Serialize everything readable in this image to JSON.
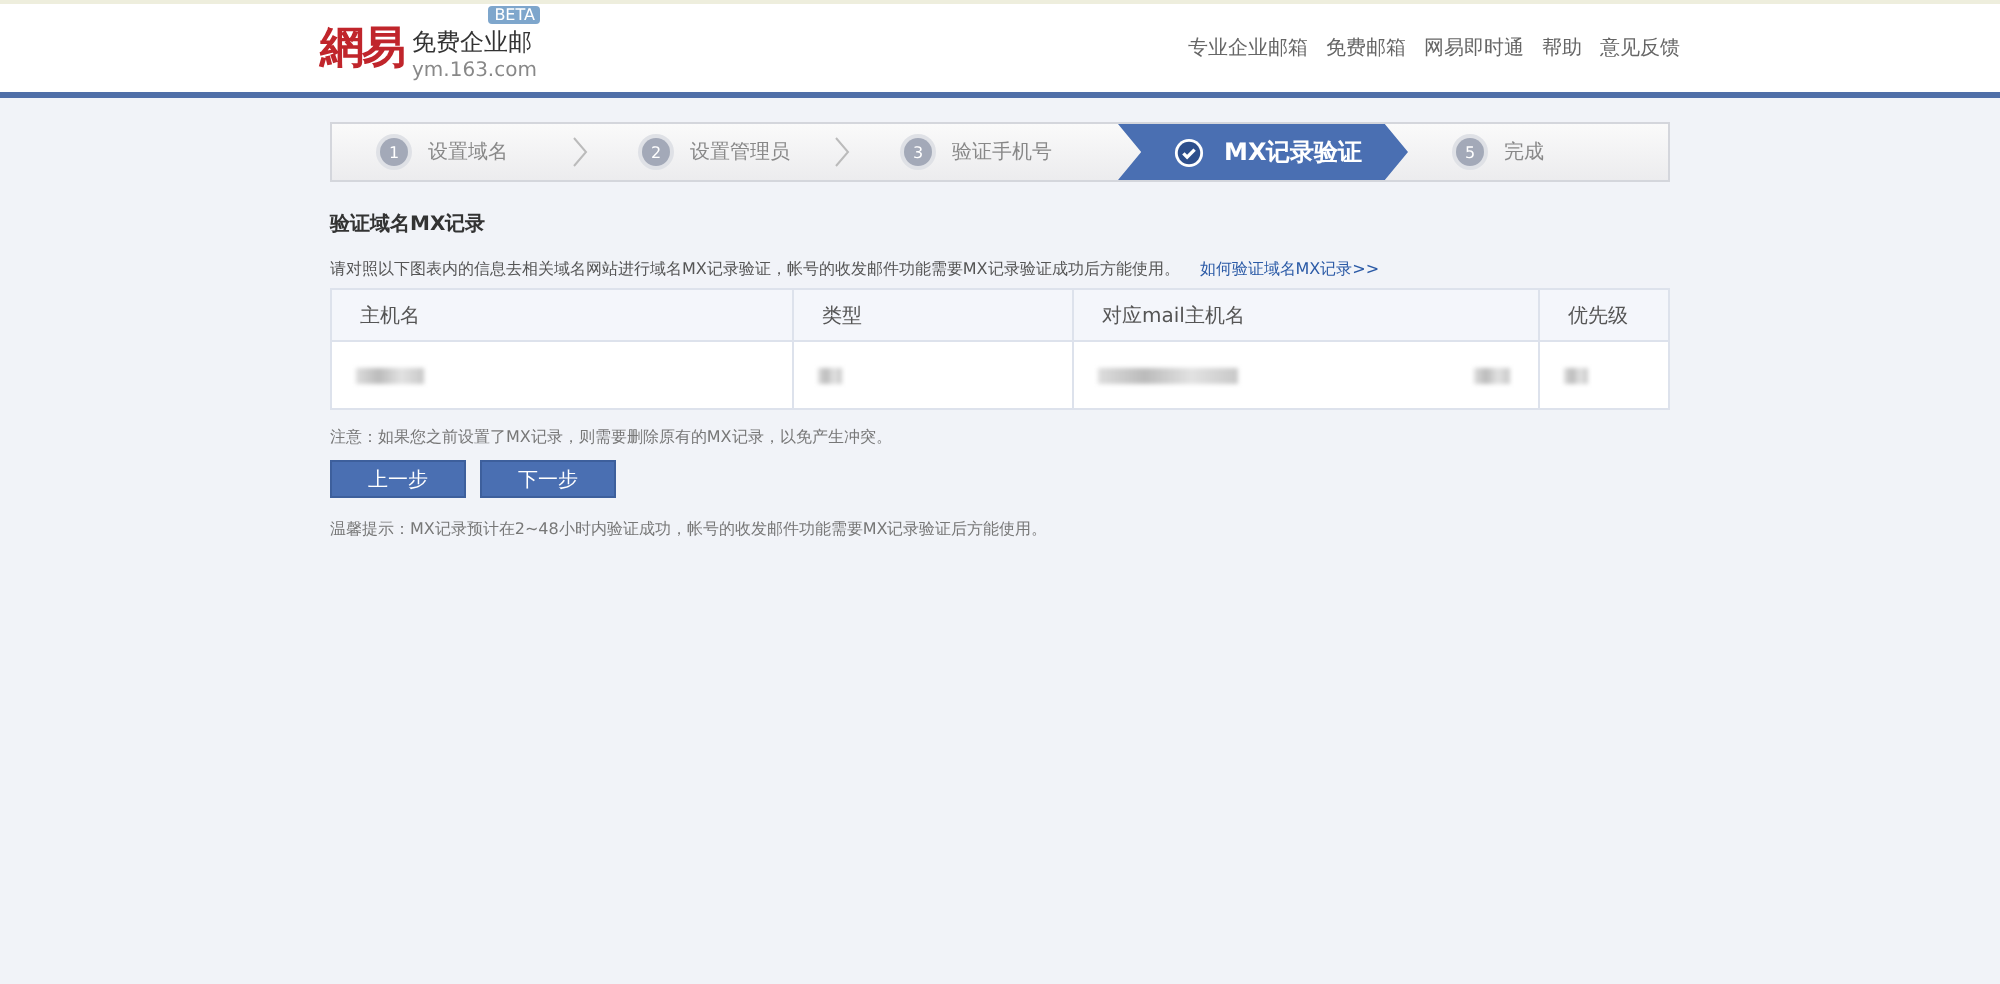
{
  "header": {
    "logo": "網易",
    "product": "免费企业邮",
    "badge": "BETA",
    "domain": "ym.163.com",
    "nav": [
      "专业企业邮箱",
      "免费邮箱",
      "网易即时通",
      "帮助",
      "意见反馈"
    ]
  },
  "steps": [
    {
      "number": "1",
      "label": "设置域名",
      "selected": false
    },
    {
      "number": "2",
      "label": "设置管理员",
      "selected": false
    },
    {
      "number": "3",
      "label": "验证手机号",
      "selected": false
    },
    {
      "label": "MX记录验证",
      "selected": true
    },
    {
      "number": "5",
      "label": "完成",
      "selected": false
    }
  ],
  "section": {
    "title": "验证域名MX记录",
    "description": "请对照以下图表内的信息去相关域名网站进行域名MX记录验证，帐号的收发邮件功能需要MX记录验证成功后方能使用。",
    "help_link": "如何验证域名MX记录>>"
  },
  "table": {
    "columns": [
      "主机名",
      "类型",
      "对应mail主机名",
      "优先级"
    ]
  },
  "note": "注意：如果您之前设置了MX记录，则需要删除原有的MX记录，以免产生冲突。",
  "buttons": [
    "上一步",
    "下一步"
  ],
  "tip": "温馨提示：MX记录预计在2~48小时内验证成功，帐号的收发邮件功能需要MX记录验证后方能使用。"
}
